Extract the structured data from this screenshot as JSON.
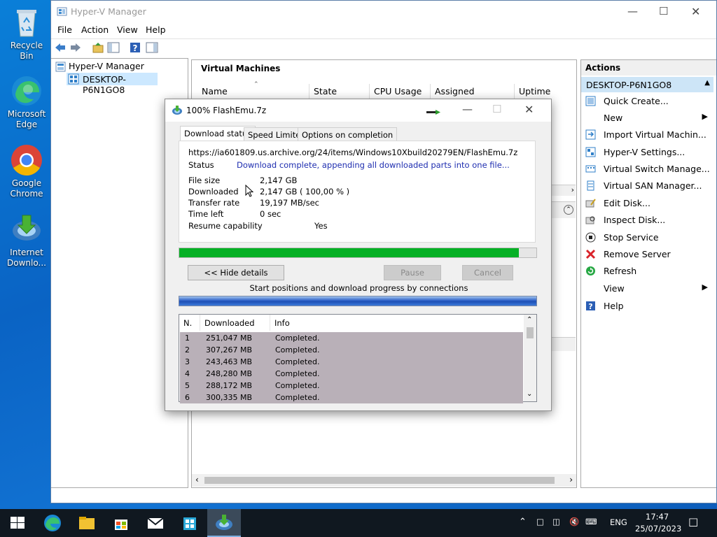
{
  "desktop": {
    "icons": [
      {
        "label": "Recycle Bin",
        "icon": "recycle-bin-icon"
      },
      {
        "label": "Microsoft Edge",
        "icon": "edge-icon"
      },
      {
        "label": "Google Chrome",
        "icon": "chrome-icon"
      },
      {
        "label": "Internet Downlo...",
        "icon": "idm-icon"
      }
    ]
  },
  "hyperv": {
    "title": "Hyper-V Manager",
    "menu": [
      "File",
      "Action",
      "View",
      "Help"
    ],
    "tree": {
      "root": "Hyper-V Manager",
      "child": "DESKTOP-P6N1GO8"
    },
    "vm_panel_title": "Virtual Machines",
    "columns": [
      "Name",
      "State",
      "CPU Usage",
      "Assigned Memory",
      "Uptime"
    ],
    "actions_title": "Actions",
    "actions_host": "DESKTOP-P6N1GO8",
    "actions": [
      {
        "label": "Quick Create...",
        "icon": "quick-create-icon"
      },
      {
        "label": "New",
        "icon": "",
        "submenu": true
      },
      {
        "label": "Import Virtual Machin...",
        "icon": "import-icon"
      },
      {
        "label": "Hyper-V Settings...",
        "icon": "settings-icon"
      },
      {
        "label": "Virtual Switch Manage...",
        "icon": "switch-icon"
      },
      {
        "label": "Virtual SAN Manager...",
        "icon": "san-icon"
      },
      {
        "label": "Edit Disk...",
        "icon": "edit-disk-icon"
      },
      {
        "label": "Inspect Disk...",
        "icon": "inspect-disk-icon"
      },
      {
        "label": "Stop Service",
        "icon": "stop-icon"
      },
      {
        "label": "Remove Server",
        "icon": "remove-icon"
      },
      {
        "label": "Refresh",
        "icon": "refresh-icon"
      },
      {
        "label": "View",
        "icon": "",
        "submenu": true
      },
      {
        "label": "Help",
        "icon": "help-icon"
      }
    ]
  },
  "idm": {
    "title": "100% FlashEmu.7z",
    "tabs": [
      "Download status",
      "Speed Limiter",
      "Options on completion"
    ],
    "url": "https://ia601809.us.archive.org/24/items/Windows10Xbuild20279EN/FlashEmu.7z",
    "status_label": "Status",
    "status_value": "Download complete, appending all downloaded parts into one file...",
    "file_size_label": "File size",
    "file_size_value": "2,147  GB",
    "downloaded_label": "Downloaded",
    "downloaded_value": "2,147  GB  ( 100,00 % )",
    "transfer_label": "Transfer rate",
    "transfer_value": "19,197  MB/sec",
    "time_left_label": "Time left",
    "time_left_value": "0 sec",
    "resume_label": "Resume capability",
    "resume_value": "Yes",
    "progress_percent": 95,
    "hide_details": "<< Hide details",
    "pause": "Pause",
    "cancel": "Cancel",
    "connections_caption": "Start positions and download progress by connections",
    "table_headers": [
      "N.",
      "Downloaded",
      "Info"
    ],
    "rows": [
      {
        "n": "1",
        "downloaded": "251,047  MB",
        "info": "Completed."
      },
      {
        "n": "2",
        "downloaded": "307,267  MB",
        "info": "Completed."
      },
      {
        "n": "3",
        "downloaded": "243,463  MB",
        "info": "Completed."
      },
      {
        "n": "4",
        "downloaded": "248,280  MB",
        "info": "Completed."
      },
      {
        "n": "5",
        "downloaded": "288,172  MB",
        "info": "Completed."
      },
      {
        "n": "6",
        "downloaded": "300,335  MB",
        "info": "Completed."
      }
    ]
  },
  "taskbar": {
    "lang": "ENG",
    "time": "17:47",
    "date": "25/07/2023"
  },
  "colors": {
    "progress_green": "#06b025",
    "selection_blue": "#cce8ff",
    "remove_red": "#d9232a"
  }
}
